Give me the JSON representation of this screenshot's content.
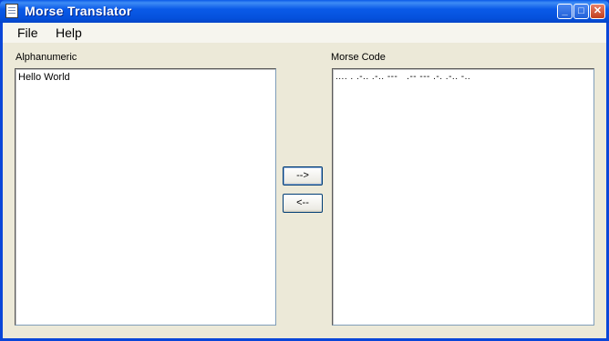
{
  "window": {
    "title": "Morse Translator"
  },
  "menu": {
    "items": [
      "File",
      "Help"
    ]
  },
  "alphanumeric": {
    "label": "Alphanumeric",
    "value": "Hello World"
  },
  "morse": {
    "label": "Morse Code",
    "value": ".... . .-.. .-.. ---   .-- --- .-. .-.. -.."
  },
  "buttons": {
    "to_morse": "-->",
    "to_alpha": "<--"
  },
  "colors": {
    "titlebar": "#0a5ae8",
    "client_bg": "#ece9d8",
    "close_button": "#c2401c"
  }
}
